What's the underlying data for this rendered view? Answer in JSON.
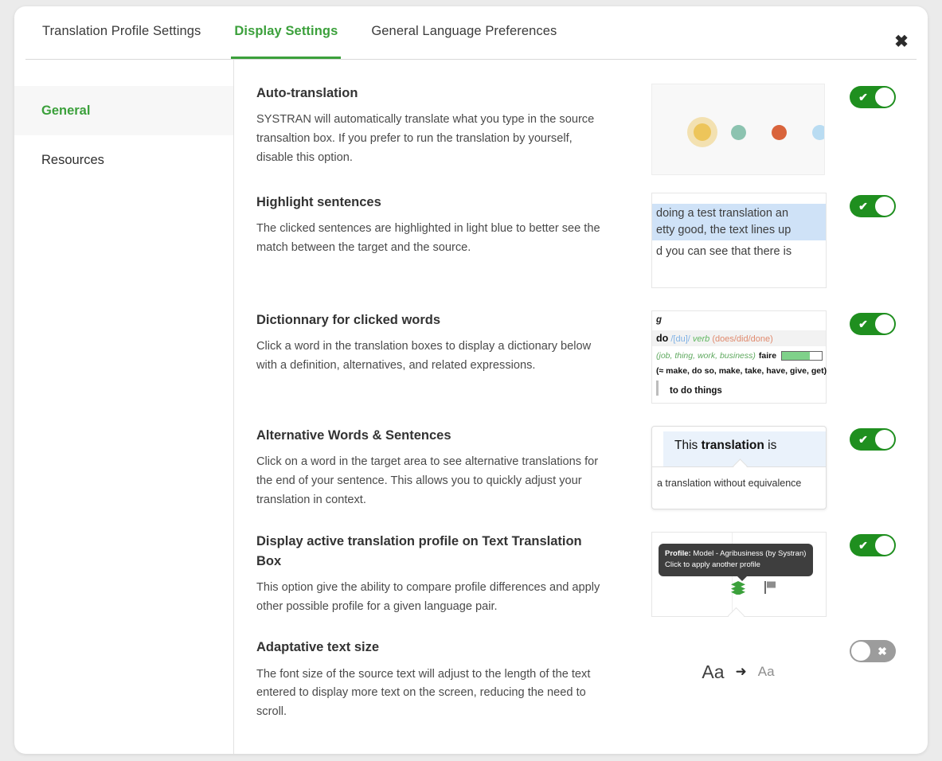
{
  "dialog": {
    "close_label": "✖"
  },
  "tabs": [
    {
      "label": "Translation Profile Settings",
      "active": false
    },
    {
      "label": "Display Settings",
      "active": true
    },
    {
      "label": "General Language Preferences",
      "active": false
    }
  ],
  "sidebar": {
    "items": [
      {
        "label": "General",
        "active": true
      },
      {
        "label": "Resources",
        "active": false
      }
    ]
  },
  "settings": [
    {
      "title": "Auto-translation",
      "description": "SYSTRAN will automatically translate what you type in the source transaltion box. If you prefer to run the translation by yourself, disable this option.",
      "toggle": "on",
      "toggle_mark": "✔"
    },
    {
      "title": "Highlight sentences",
      "description": "The clicked sentences are highlighted in light blue to better see the match between the target and the source.",
      "toggle": "on",
      "toggle_mark": "✔"
    },
    {
      "title": "Dictionnary for clicked words",
      "description": "Click a word in the translation boxes to display a dictionary below with a definition, alternatives, and related expressions.",
      "toggle": "on",
      "toggle_mark": "✔"
    },
    {
      "title": "Alternative Words & Sentences",
      "description": "Click on a word in the target area to see alternative translations for the end of your sentence. This allows you to quickly adjust your translation in context.",
      "toggle": "on",
      "toggle_mark": "✔"
    },
    {
      "title": "Display active translation profile on Text Translation Box",
      "description": "This option give the ability to compare profile differences and apply other possible profile for a given language pair.",
      "toggle": "on",
      "toggle_mark": "✔"
    },
    {
      "title": "Adaptative text size",
      "description": "The font size of the source text will adjust to the length of the text entered to display more text on the screen, reducing the need to scroll.",
      "toggle": "off",
      "toggle_mark": "✖"
    }
  ],
  "previews": {
    "dots": {
      "colors": [
        "#edc55a",
        "#8cc3b0",
        "#d9643c",
        "#b9dcf2"
      ]
    },
    "highlight": {
      "line1": "doing a test translation an",
      "line2": "etty good, the text lines up",
      "line3": "d you can see that there is"
    },
    "dictionary": {
      "gloss": "g",
      "headword": "do",
      "ipa": "/[du]/",
      "pos": "verb",
      "forms": "(does/did/done)",
      "context": "(job, thing, work, business)",
      "translation": "faire",
      "synonyms": "(≈ make, do so, make, take, have, give, get)",
      "example": "to do things"
    },
    "alternative": {
      "selected_prefix": "This ",
      "selected_word": "translation",
      "selected_suffix": " is",
      "suggestion": "a translation without equivalence"
    },
    "profile": {
      "tooltip_label": "Profile:",
      "tooltip_value": " Model - Agribusiness (by Systran)",
      "tooltip_hint": "Click to apply another profile",
      "layers_icon_color": "#3ba03b",
      "flag_icon_color": "#6b6b6b"
    },
    "adaptative": {
      "big": "Aa",
      "arrow": "➜",
      "small": "Aa"
    }
  },
  "colors": {
    "accent_green": "#3ba03b",
    "toggle_on": "#1f8f1f",
    "toggle_off": "#9c9c9c",
    "highlight_blue": "#cfe2f7"
  }
}
